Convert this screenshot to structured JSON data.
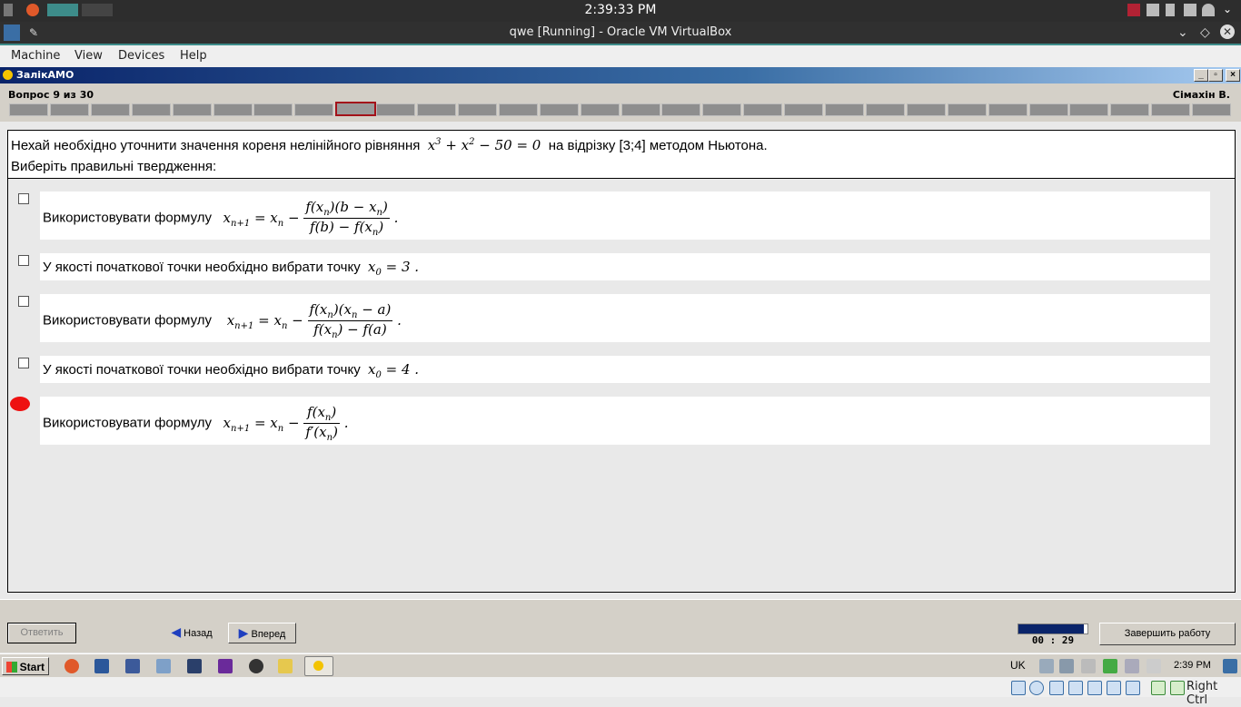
{
  "host_panel": {
    "time": "2:39:33 PM"
  },
  "vbox": {
    "title": "qwe [Running] - Oracle VM VirtualBox",
    "menu": [
      "Machine",
      "View",
      "Devices",
      "Help"
    ],
    "host_key": "Right Ctrl"
  },
  "app": {
    "title": "ЗалікАМО",
    "question_counter": "Вопрос 9 из 30",
    "student": "Сімахін В.",
    "total_questions": 30,
    "current_question": 9
  },
  "question": {
    "line1_before": "Нехай необхідно уточнити значення кореня нелінійного рівняння",
    "equation": "x³ + x² − 50 = 0",
    "line1_after": "на відрізку [3;4] методом Ньютона.",
    "line2": "Виберіть правильні твердження:"
  },
  "options": [
    {
      "text": "Використовувати формулу",
      "formula_lhs": "xn+1 = xn −",
      "num": "f(xn)(b − xn)",
      "den": "f(b) − f(xn)",
      "checked": false
    },
    {
      "text": "У якості початкової точки необхідно вибрати точку",
      "formula": "x0 = 3",
      "checked": false
    },
    {
      "text": "Використовувати формулу",
      "formula_lhs": "xn+1 = xn −",
      "num": "f(xn)(xn − a)",
      "den": "f(xn) − f(a)",
      "checked": false
    },
    {
      "text": "У якості початкової точки необхідно вибрати точку",
      "formula": "x0 = 4",
      "checked": false
    },
    {
      "text": "Використовувати формулу",
      "formula_lhs": "xn+1 = xn −",
      "num": "f(xn)",
      "den": "f′(xn)",
      "checked": false
    }
  ],
  "bottom": {
    "answer": "Ответить",
    "back": "Назад",
    "next": "Вперед",
    "finish": "Завершить работу",
    "timer": "00 : 29",
    "timer_progress": 0.95
  },
  "taskbar": {
    "start": "Start",
    "lang": "UK",
    "time": "2:39 PM"
  },
  "colors": {
    "title_gradient_start": "#0a246a",
    "current_segment": "#a3121a",
    "accent": "#3d8c8a"
  }
}
